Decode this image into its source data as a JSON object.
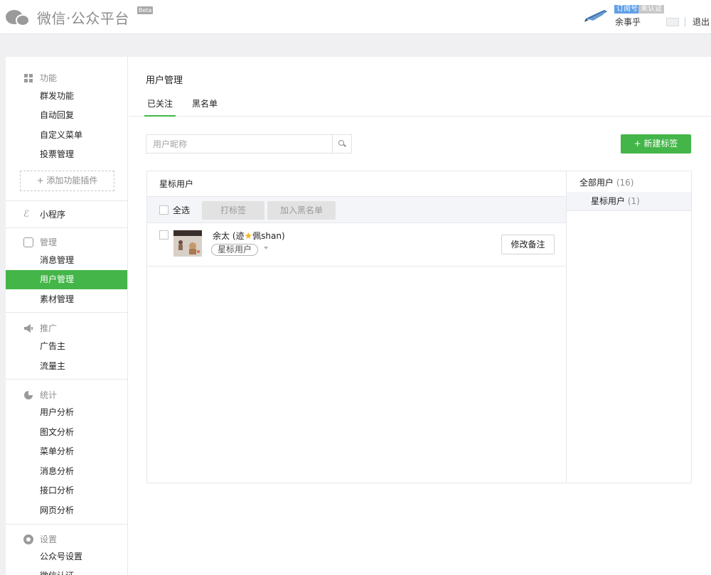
{
  "header": {
    "brand_title": "微信·公众平台",
    "beta_label": "Beta",
    "account_type": "订阅号",
    "account_status": "未认证",
    "account_name": "余事乎",
    "logout_label": "退出"
  },
  "sidebar": {
    "sections": {
      "function": {
        "title": "功能",
        "items": [
          "群发功能",
          "自动回复",
          "自定义菜单",
          "投票管理"
        ],
        "add_plugin": "+ 添加功能插件"
      },
      "miniprogram": {
        "title": "小程序"
      },
      "manage": {
        "title": "管理",
        "items": [
          "消息管理",
          "用户管理",
          "素材管理"
        ]
      },
      "promote": {
        "title": "推广",
        "items": [
          "广告主",
          "流量主"
        ]
      },
      "stats": {
        "title": "统计",
        "items": [
          "用户分析",
          "图文分析",
          "菜单分析",
          "消息分析",
          "接口分析",
          "网页分析"
        ]
      },
      "settings": {
        "title": "设置",
        "items": [
          "公众号设置",
          "微信认证"
        ]
      }
    },
    "active_item": "用户管理"
  },
  "main": {
    "page_title": "用户管理",
    "tabs": [
      {
        "label": "已关注",
        "active": true
      },
      {
        "label": "黑名单",
        "active": false
      }
    ],
    "search": {
      "placeholder": "用户昵称",
      "value": ""
    },
    "new_tag_button": "+ 新建标签",
    "list": {
      "title": "星标用户",
      "select_all_label": "全选",
      "tag_button": "打标签",
      "blacklist_button": "加入黑名单",
      "users": [
        {
          "name_prefix": "余太 (迹",
          "name_suffix": "佩shan)",
          "tag": "星标用户",
          "edit_remark_label": "修改备注"
        }
      ]
    },
    "groups": {
      "all_label": "全部用户",
      "all_count": "(16)",
      "items": [
        {
          "label": "星标用户",
          "count": "(1)"
        }
      ]
    }
  },
  "colors": {
    "accent_green": "#44b549",
    "account_type_blue": "#5fa0e8",
    "star": "#f3b21a"
  },
  "icons": [
    "wechat-logo-icon",
    "grid-icon",
    "miniprogram-icon",
    "inbox-icon",
    "megaphone-icon",
    "pie-chart-icon",
    "gear-icon",
    "search-icon",
    "mail-icon",
    "star-icon",
    "caret-down-icon"
  ]
}
